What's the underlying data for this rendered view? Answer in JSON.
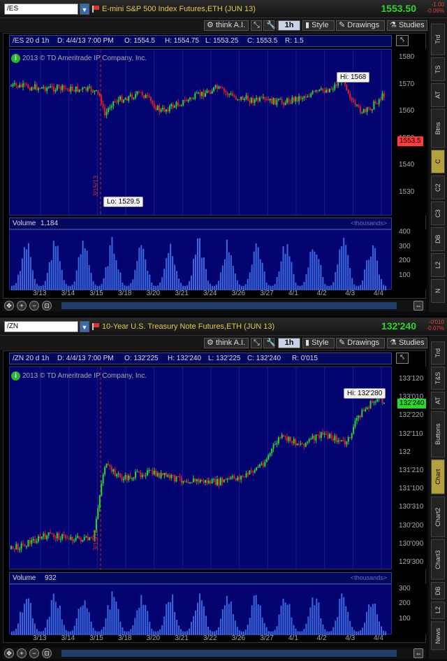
{
  "charts": [
    {
      "symbol": "/ES",
      "description": "E-mini S&P 500 Index Futures,ETH (JUN 13)",
      "last": "1553.50",
      "change": "-1.00",
      "change_pct": "-0.06%",
      "toolbar": {
        "think": "think A.I.",
        "period": "1h",
        "style": "Style",
        "drawings": "Drawings",
        "studies": "Studies"
      },
      "info": {
        "name": "/ES 20 d 1h",
        "date": "D: 4/4/13 7:00 PM",
        "open": "O: 1554.5",
        "high": "H: 1554.75",
        "low": "L: 1553.25",
        "close": "C: 1553.5",
        "range": "R: 1.5"
      },
      "copyright": "2013 © TD Ameritrade IP Company, Inc.",
      "y_ticks": [
        "1580",
        "1570",
        "1560",
        "1550",
        "1540",
        "1530"
      ],
      "y_values": [
        1580,
        1570,
        1560,
        1550,
        1540,
        1530
      ],
      "price_tag": "1553.5",
      "price_tag_value": 1553.5,
      "hi": "Hi: 1568",
      "lo": "Lo: 1529.5",
      "event_label": "3/15/13",
      "volume_label": "Volume",
      "volume_value": "1,184",
      "volume_unit": "<thousands>",
      "vol_ticks": [
        "400",
        "300",
        "200",
        "100"
      ],
      "vol_values": [
        400,
        300,
        200,
        100
      ],
      "x_ticks": [
        "3/13",
        "3/14",
        "3/15",
        "3/18",
        "3/20",
        "3/21",
        "3/24",
        "3/26",
        "3/27",
        "4/1",
        "4/2",
        "4/3",
        "4/4"
      ],
      "side_tabs": [
        "Trd",
        "TS",
        "AT",
        "Btns",
        "C",
        "C2",
        "C3",
        "DB",
        "L2",
        "N"
      ],
      "selected_tab": "C"
    },
    {
      "symbol": "/ZN",
      "description": "10-Year U.S. Treasury Note Futures,ETH (JUN 13)",
      "last": "132'240",
      "change": "-0'010",
      "change_pct": "-0.07%",
      "toolbar": {
        "think": "think A.I.",
        "period": "1h",
        "style": "Style",
        "drawings": "Drawings",
        "studies": "Studies"
      },
      "info": {
        "name": "/ZN 20 d 1h",
        "date": "D: 4/4/13 7:00 PM",
        "open": "O: 132'225",
        "high": "H: 132'240",
        "low": "L: 132'225",
        "close": "C: 132'240",
        "range": "R: 0'015"
      },
      "copyright": "2013 © TD Ameritrade IP Company, Inc.",
      "y_ticks": [
        "133'120",
        "133'010",
        "132'220",
        "132'110",
        "132",
        "131'210",
        "131'100",
        "130'310",
        "130'200",
        "130'090",
        "129'300"
      ],
      "y_values": [
        11,
        10,
        9,
        8,
        7,
        6,
        5,
        4,
        3,
        2,
        1
      ],
      "price_tag": "132'240",
      "price_tag_value": 9.2,
      "hi": "Hi: 132'280",
      "lo": "",
      "event_label": "3/15/13",
      "volume_label": "Volume",
      "volume_value": "932",
      "volume_unit": "<thousands>",
      "vol_ticks": [
        "300",
        "200",
        "100"
      ],
      "vol_values": [
        300,
        200,
        100
      ],
      "x_ticks": [
        "3/13",
        "3/14",
        "3/15",
        "3/18",
        "3/20",
        "3/21",
        "3/22",
        "3/26",
        "3/27",
        "4/1",
        "4/2",
        "4/3",
        "4/4"
      ],
      "side_tabs": [
        "Trd",
        "T&S",
        "AT",
        "Buttons",
        "Chart",
        "Chart2",
        "Chart3",
        "DB",
        "L2",
        "News"
      ],
      "selected_tab": "Chart"
    }
  ],
  "colors": {
    "up": "#2fd52f",
    "down": "#e02020",
    "plot_bg": "#040470",
    "volume": "#3a68e0",
    "tag_up": "#2fd52f",
    "tag_down": "#ff3b3b"
  }
}
